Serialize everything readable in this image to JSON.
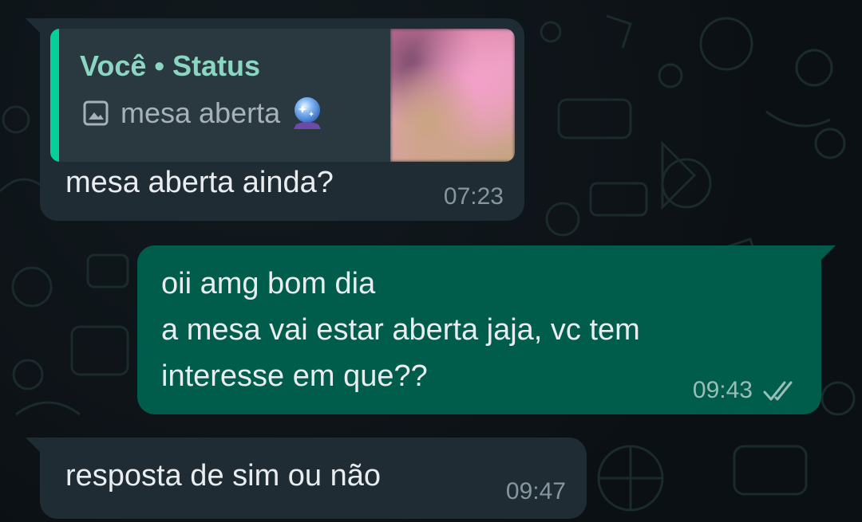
{
  "colors": {
    "chat_background": "#0b1014",
    "incoming_bubble": "#1f2c33",
    "outgoing_bubble": "#005c4b",
    "quote_accent": "#06cf9c",
    "quote_author": "#8bd6c3",
    "read_ticks": "#99beb7"
  },
  "messages": [
    {
      "direction": "incoming",
      "quoted": {
        "author": "Você • Status",
        "icon": "image-icon",
        "text": "mesa aberta",
        "emoji": "crystal-ball-icon",
        "has_thumbnail": true
      },
      "text": "mesa aberta ainda?",
      "time": "07:23"
    },
    {
      "direction": "outgoing",
      "lines": [
        "oii amg bom dia",
        "a mesa vai estar aberta jaja, vc tem",
        "interesse em que??"
      ],
      "time": "09:43",
      "status_icon": "double-check-icon"
    },
    {
      "direction": "incoming",
      "text": "resposta de sim ou não",
      "time": "09:47"
    }
  ]
}
